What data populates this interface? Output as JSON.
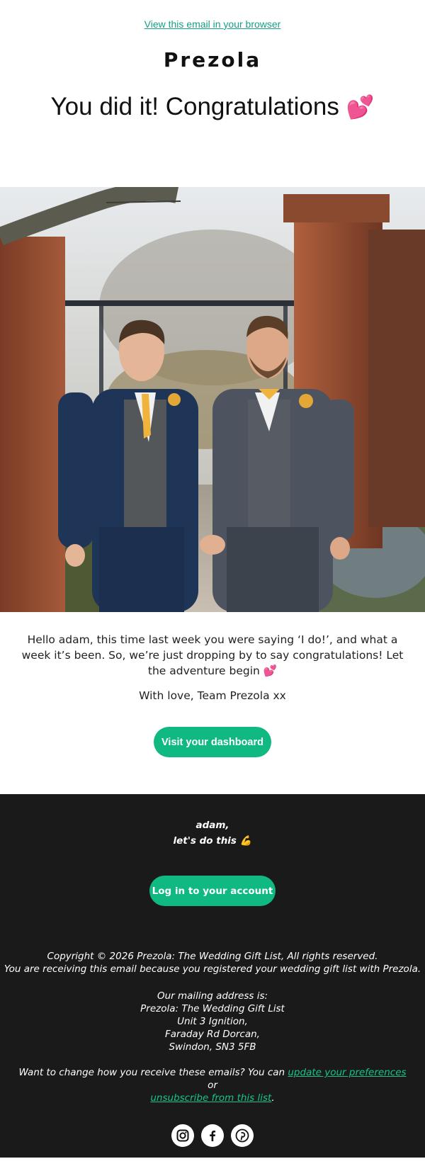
{
  "header": {
    "browser_link": "View this email in your browser",
    "logo": "Prezola",
    "headline": "You did it! Congratulations",
    "headline_emoji": "💕"
  },
  "hero": {
    "image_subject": "wedding-couple-photo"
  },
  "message": {
    "body": "Hello adam,  this time last week you were saying ‘I do!’, and what a week it’s been. So, we’re just dropping by to say congratulations! Let the adventure begin 💕",
    "signoff": "With love, Team Prezola xx",
    "cta_label": "Visit your dashboard"
  },
  "footer": {
    "greet_line1": "adam,",
    "greet_line2": "let's do this 💪",
    "login_label": "Log in to your account",
    "copyright_line1": "Copyright © 2026 Prezola: The Wedding Gift List, All rights reserved.",
    "copyright_line2": "You are receiving this email because you registered your wedding gift list with Prezola.",
    "mailing_heading": "Our mailing address is:",
    "address": [
      "Prezola: The Wedding Gift List",
      "Unit 3 Ignition,",
      "Faraday Rd Dorcan,",
      "Swindon, SN3 5FB"
    ],
    "prefs_text_before": "Want to change how you receive these emails? You can ",
    "prefs_link": "update your preferences",
    "prefs_text_mid": " or ",
    "unsub_link": "unsubscribe from this list",
    "prefs_text_after": ".",
    "social": [
      "instagram-icon",
      "facebook-icon",
      "pinterest-icon"
    ]
  },
  "colors": {
    "accent": "#0fb981",
    "footer_bg": "#1a1a1a",
    "link": "#16a085"
  }
}
